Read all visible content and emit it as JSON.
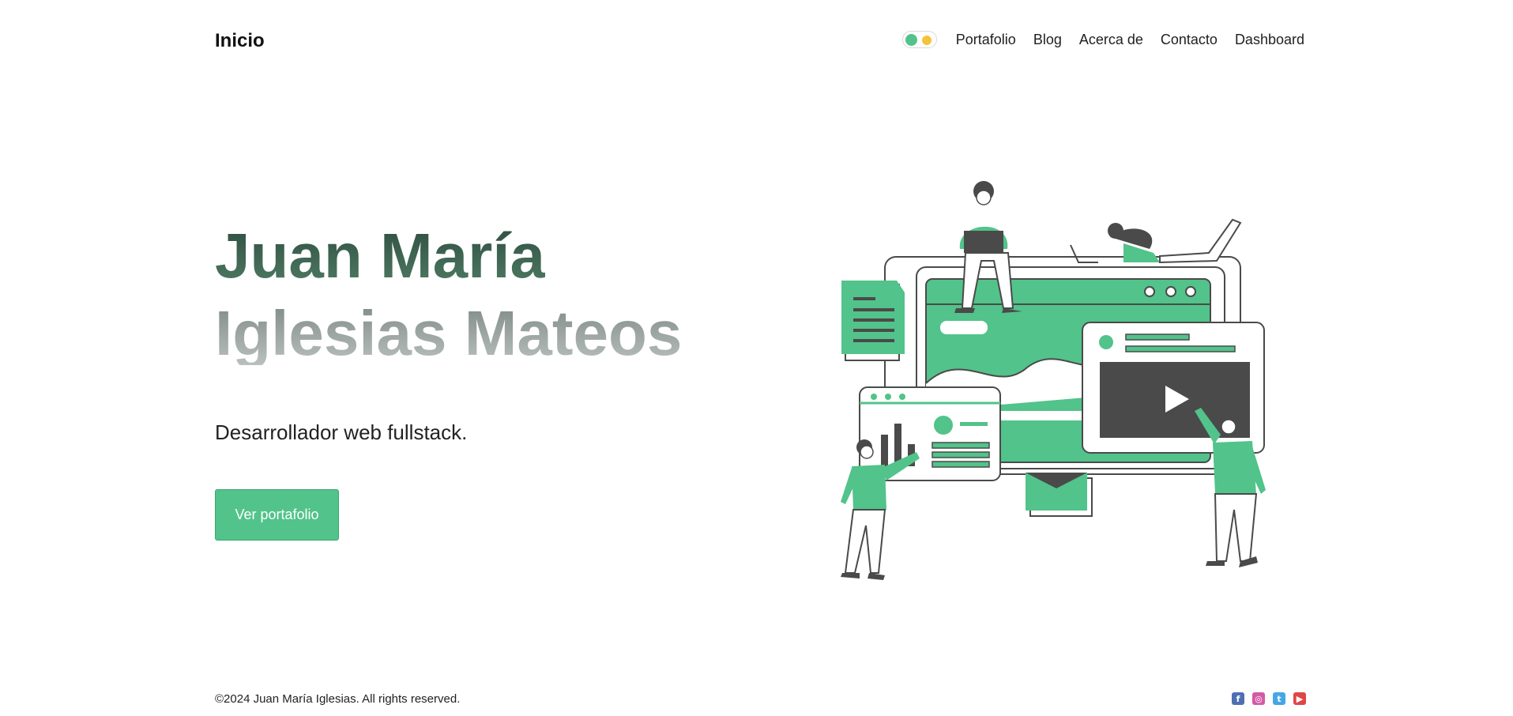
{
  "header": {
    "brand": "Inicio",
    "nav": [
      "Portafolio",
      "Blog",
      "Acerca de",
      "Contacto",
      "Dashboard"
    ]
  },
  "hero": {
    "name_line1": "Juan María",
    "name_line2": "Iglesias Mateos",
    "subtitle": "Desarrollador web fullstack.",
    "cta_label": "Ver portafolio"
  },
  "footer": {
    "copyright": "©2024 Juan María Iglesias. All rights reserved.",
    "socials": [
      {
        "icon": "facebook-icon",
        "color": "#4f6fb3"
      },
      {
        "icon": "instagram-icon",
        "color": "#d45aa7"
      },
      {
        "icon": "twitter-icon",
        "color": "#45a6e6"
      },
      {
        "icon": "youtube-icon",
        "color": "#e04646"
      }
    ]
  },
  "colors": {
    "accent": "#52c38a",
    "dark": "#4a4a4a"
  }
}
